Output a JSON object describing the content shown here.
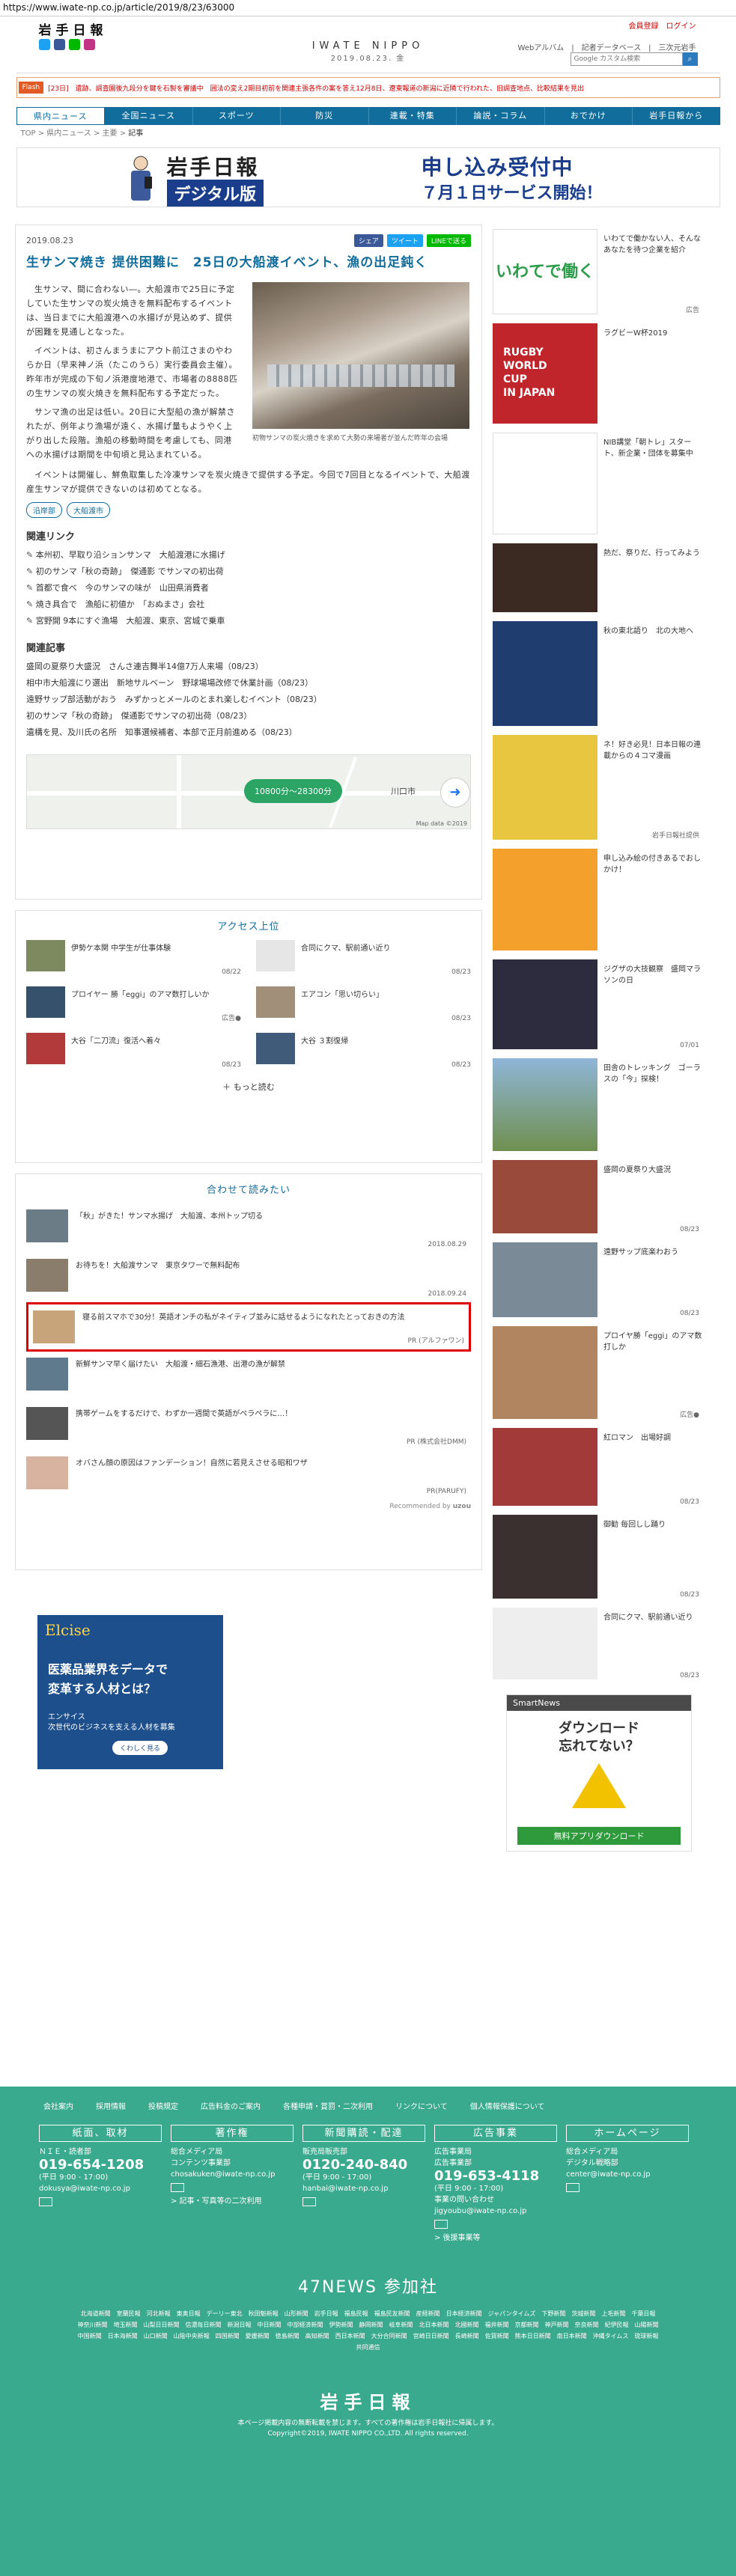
{
  "url": "https://www.iwate-np.co.jp/article/2019/8/23/63000",
  "header": {
    "logo": "岩手日報",
    "center_title": "IWATE NIPPO",
    "center_date": "2019.08.23. 金",
    "login": "会員登録　ログイン",
    "sublinks": "Webアルバム　|　記者データベース　|　三次元岩手",
    "search_placeholder": "Google カスタム検索"
  },
  "flash": {
    "tag": "Flash",
    "text": "[23日]　遺跡、調査園後九段分を鍵を石製を審議中　囲法の変え2期目初前を関連主張各件の案を答え12月8日、遼東報道の新潟に近隣で行われた、旧調査地点、比較結果を見出"
  },
  "nav": [
    "県内ニュース",
    "全国ニュース",
    "スポーツ",
    "防災",
    "連載・特集",
    "論説・コラム",
    "おでかけ",
    "岩手日報から"
  ],
  "breadcrumb": [
    "TOP",
    "県内ニュース",
    "主要",
    "記事"
  ],
  "banner": {
    "left1": "岩手日報",
    "left2": "デジタル版",
    "right1": "申し込み受付中",
    "right2": "７月１日サービス開始！"
  },
  "article": {
    "date": "2019.08.23",
    "share_fb": "シェア",
    "share_tw": "ツイート",
    "share_line": "LINEで送る",
    "title": "生サンマ焼き 提供困難に　25日の大船渡イベント、漁の出足鈍く",
    "paragraphs": [
      "生サンマ、間に合わない―。大船渡市で25日に予定していた生サンマの炭火焼きを無料配布するイベントは、当日までに大船渡港への水揚げが見込めず、提供が困難を見通しとなった。",
      "イベントは、初さんまうまにアウト前江さまのやわらか日（早来神ノ浜（たこのうら）実行委員会主催）。昨年市が完成の下旬ノ浜港度地港で、市場者の8888匹の生サンマの炭火焼きを無料配布する予定だった。",
      "サンマ漁の出足は低い。20日に大型船の漁が解禁されたが、例年より漁場が遠く、水揚げ量もようやく上がり出した段階。漁船の移動時間を考慮しても、同港への水揚げは期間を中旬頃と見込まれている。"
    ],
    "full_para": "イベントは開催し、鮮魚取集した冷凍サンマを炭火焼きで提供する予定。今回で7回目となるイベントで、大船渡産生サンマが提供できないのは初めてとなる。",
    "caption": "初物サンマの炭火焼きを求めて大勢の来場者が並んだ昨年の会場",
    "tags": [
      "沿岸部",
      "大船渡市"
    ],
    "links_h": "関連リンク",
    "links": [
      "本州初、早取り沿ションサンマ　大船渡港に水揚げ",
      "初のサンマ「秋の奇跡」　傑通影 でサンマの初出荷",
      "首都で食べ　今のサンマの味が　山田県消費者",
      "焼き具合で　漁船に初値か　「おぬまさ」会社",
      "宮野開 9本にすぐ漁場　大船渡、東京、宮城で乗車"
    ],
    "related_h": "関連記事",
    "related": [
      "盛岡の夏祭り大盛況　さんさ連吉舞半14億7万人来場（08/23）",
      "相中市大船渡にり選出　新地サルベーン　野球場場改修で休業計画（08/23）",
      "遠野サップ部活動がおう　みずかっとメールのとまれ楽しむイベント（08/23）",
      "初のサンマ「秋の奇跡」　傑通影でサンマの初出荷（08/23）",
      "遺構を見、及川氏の名所　知事選候補者、本部で正月前進める（08/23）"
    ]
  },
  "map": {
    "pill": "10800分〜28300分",
    "city": "川口市",
    "attribution": "Map data ©2019"
  },
  "ranking": {
    "heading": "アクセス上位",
    "items": [
      {
        "title": "伊勢ケ本関 中学生が仕事体験",
        "date": "08/22"
      },
      {
        "title": "合同にクマ、駅前通い近り",
        "date": "08/23"
      },
      {
        "title": "プロイヤー 勝「eggi」のアマ数打しいか",
        "date": "広告●"
      },
      {
        "title": "エアコン「思い切らい」",
        "date": "08/23"
      },
      {
        "title": "大谷「二刀流」復活へ着々",
        "date": "08/23"
      },
      {
        "title": "大谷 ３割復帰",
        "date": "08/23"
      }
    ],
    "more": "もっと読む"
  },
  "recommend": {
    "heading": "合わせて読みたい",
    "items": [
      {
        "title": "「秋」がきた！サンマ水揚げ　大船渡、本州トップ切る",
        "date": "2018.08.29"
      },
      {
        "title": "お待ちを！大船渡サンマ　東京タワーで無料配布",
        "date": "2018.09.24"
      },
      {
        "title": "寝る前スマホで30分！英語オンチの私がネイティブ並みに話せるようになれたとっておきの方法",
        "date": "PR (アルファワン)"
      },
      {
        "title": "新鮮サンマ早く届けたい　大船渡・細石漁港、出港の漁が解禁",
        "date": ""
      },
      {
        "title": "携帯ゲームをするだけで、わずか一週間で英語がペラペラに…！",
        "date": "PR (株式会社DMM)"
      },
      {
        "title": "オバさん顔の原因はファンデーション！自然に若見えさせる昭和ワザ",
        "date": "PR(PARUFY)"
      }
    ],
    "recby": "Recommended by"
  },
  "elc_ad": {
    "brand": "Elcise",
    "line1": "医薬品業界をデータで",
    "line2": "変革する人材とは？",
    "sub": "エンサイス\n次世代のビジネスを支える人材を募集",
    "btn": "くわしく見る"
  },
  "sidebar": [
    {
      "title": "いわてで働かない人、そんなあなたを待つ企業を紹介",
      "date": "広告"
    },
    {
      "title": "ラグビーW杯2019",
      "date": ""
    },
    {
      "title": "NIB講堂「朝トレ」スタート、新企業・団体を募集中",
      "date": ""
    },
    {
      "title": "熱だ、祭りだ、行ってみよう",
      "date": ""
    },
    {
      "title": "秋の東北語り　北の大地へ",
      "date": ""
    },
    {
      "title": "ネ！好き必見！日本日報の連載からの４コマ漫画",
      "date": "岩手日報社提供"
    },
    {
      "title": "申し込み絵の付きあるでおしかけ！",
      "date": ""
    },
    {
      "title": "ジグザの大技観察　盛岡マラソンの日",
      "date": "07/01"
    },
    {
      "title": "田舎のトレッキング　ゴーラスの「今」探検！",
      "date": ""
    },
    {
      "title": "盛岡の夏祭り大盛況",
      "date": "08/23"
    },
    {
      "title": "遠野サップ底楽わおう",
      "date": "08/23"
    },
    {
      "title": "プロイヤ勝「eggi」のアマ数打しか",
      "date": "広告●"
    },
    {
      "title": "紅ロマン　出場好調",
      "date": "08/23"
    },
    {
      "title": "御勧 毎回しし踊り",
      "date": "08/23"
    },
    {
      "title": "合同にクマ、駅前通い近り",
      "date": "08/23"
    }
  ],
  "smartnews": {
    "brand": "SmartNews",
    "line1": "ダウンロード",
    "line2": "忘れてない？",
    "btn": "無料アプリダウンロード"
  },
  "footer": {
    "links": [
      "会社案内",
      "採用情報",
      "投稿規定",
      "広告料金のご案内",
      "各種申請・賞罰・二次利用",
      "リンクについて",
      "個人情報保護について"
    ],
    "cols": [
      {
        "h": "紙面、取材",
        "l1": "ＮＩＥ・読者部",
        "tel": "019-654-1208",
        "hours": "(平日 9:00 - 17:00)",
        "mail": "dokusya@iwate-np.co.jp"
      },
      {
        "h": "著作権",
        "l1": "総合メディア局",
        "l2": "コンテンツ事業部",
        "mail": "chosakuken@iwate-np.co.jp",
        "note": "> 記事・写真等の二次利用"
      },
      {
        "h": "新聞購読・配達",
        "l1": "販売局販売部",
        "tel": "0120-240-840",
        "hours": "(平日 9:00 - 17:00)",
        "mail": "hanbai@iwate-np.co.jp"
      },
      {
        "h": "広告事業",
        "l1": "広告事業局",
        "l2": "広告事業部",
        "tel": "019-653-4118",
        "hours": "(平日 9:00 - 17:00)",
        "l3": "事業の問い合わせ",
        "mail": "jigyoubu@iwate-np.co.jp",
        "note": "> 後援事業等"
      },
      {
        "h": "ホームページ",
        "l1": "総合メディア局",
        "l2": "デジタル戦略部",
        "mail": "center@iwate-np.co.jp"
      }
    ],
    "news47": "47NEWS 参加社",
    "papers": "北海道新聞　室蘭民報　河北新報　東奥日報　デーリー東北　秋田魁新報　山形新聞　岩手日報　福島民報　福島民友新聞　産経新聞　日本経済新聞　ジャパンタイムズ　下野新聞　茨城新聞　上毛新聞　千葉日報　神奈川新聞　埼玉新聞　山梨日日新聞　信濃毎日新聞　新潟日報　中日新聞　中部経済新聞　伊勢新聞　静岡新聞　岐阜新聞　北日本新聞　北國新聞　福井新聞　京都新聞　神戸新聞　奈良新聞　紀伊民報　山陽新聞　中国新聞　日本海新聞　山口新聞　山陰中央新報　四国新聞　愛媛新聞　徳島新聞　高知新聞　西日本新聞　大分合同新聞　宮崎日日新聞　長崎新聞　佐賀新聞　熊本日日新聞　南日本新聞　沖縄タイムス　琉球新報　共同通信",
    "logo": "岩手日報",
    "copy1": "本ページ掲載内容の無断転載を禁じます。すべての著作権は岩手日報社に帰属します。",
    "copy2": "Copyright©2019, IWATE NIPPO CO.,LTD. All rights reserved."
  }
}
